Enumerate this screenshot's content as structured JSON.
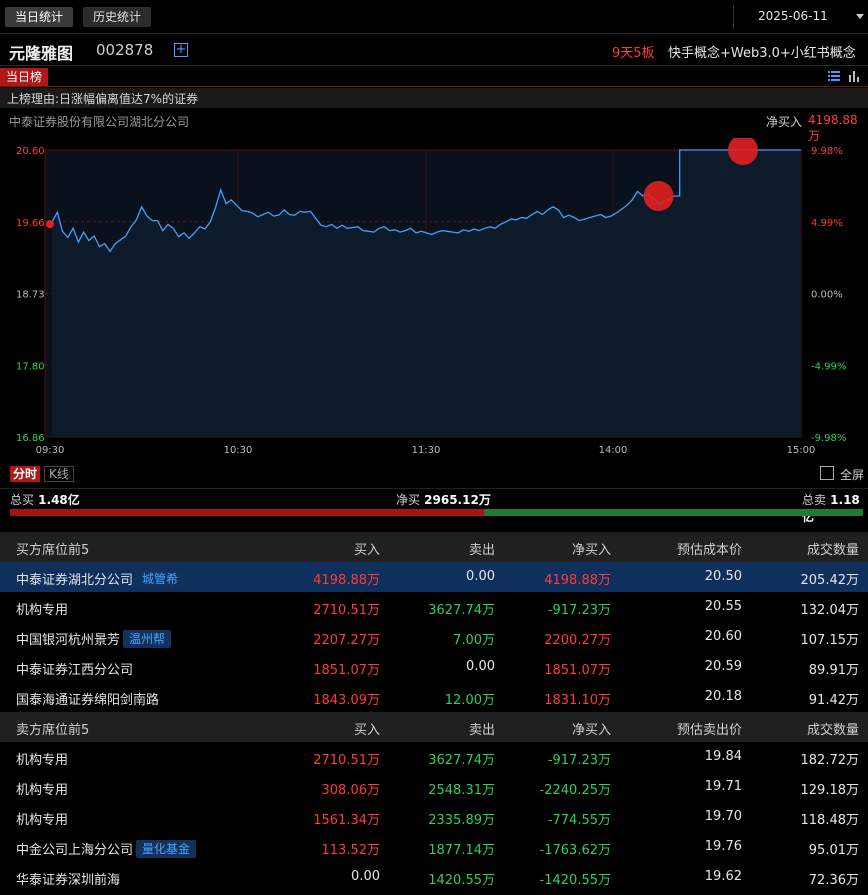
{
  "top_tabs": {
    "today": "当日统计",
    "history": "历史统计"
  },
  "date": "2025-06-11",
  "stock": {
    "name": "元隆雅图",
    "code": "002878",
    "add_symbol": "+",
    "board_count": "9天5板",
    "concepts": "快手概念+Web3.0+小红书概念"
  },
  "rank_tab": "当日榜",
  "reason": "上榜理由:日涨幅偏离值达7%的证券",
  "broker": {
    "name": "中泰证券股份有限公司湖北分公司",
    "net_label": "净买入",
    "net_value": "4198.88万"
  },
  "chart_data": {
    "type": "line",
    "y_price_ticks": [
      "20.60",
      "19.66",
      "18.73",
      "17.80",
      "16.86"
    ],
    "y_pct_ticks": [
      "9.98%",
      "4.99%",
      "0.00%",
      "-4.99%",
      "-9.98%"
    ],
    "x_ticks": [
      "09:30",
      "10:30",
      "11:30",
      "14:00",
      "15:00"
    ],
    "ylim": [
      16.86,
      20.6
    ],
    "prev_close": 18.73,
    "grid": true,
    "series": [
      {
        "values": [
          19.66,
          19.79,
          19.54,
          19.46,
          19.58,
          19.4,
          19.53,
          19.42,
          19.48,
          19.34,
          19.38,
          19.28,
          19.38,
          19.43,
          19.48,
          19.6,
          19.69,
          19.86,
          19.74,
          19.68,
          19.68,
          19.55,
          19.63,
          19.58,
          19.47,
          19.52,
          19.45,
          19.52,
          19.6,
          19.57,
          19.66,
          19.85,
          20.08,
          19.9,
          19.95,
          19.88,
          19.81,
          19.8,
          19.78,
          19.73,
          19.76,
          19.79,
          19.74,
          19.75,
          19.82,
          19.76,
          19.75,
          19.8,
          19.79,
          19.8,
          19.71,
          19.62,
          19.6,
          19.63,
          19.58,
          19.62,
          19.58,
          19.59,
          19.6,
          19.55,
          19.54,
          19.53,
          19.58,
          19.6,
          19.55,
          19.56,
          19.53,
          19.55,
          19.58,
          19.52,
          19.54,
          19.52,
          19.5,
          19.53,
          19.55,
          19.54,
          19.53,
          19.52,
          19.56,
          19.54,
          19.57,
          19.55,
          19.58,
          19.6,
          19.58,
          19.63,
          19.66,
          19.7,
          19.69,
          19.72,
          19.71,
          19.76,
          19.8,
          19.76,
          19.82,
          19.86,
          19.82,
          19.72,
          19.75,
          19.72,
          19.68,
          19.7,
          19.72,
          19.74,
          19.76,
          19.72,
          19.74,
          19.78,
          19.83,
          19.88,
          19.95,
          20.06,
          20.0,
          20.03,
          19.97,
          19.9,
          19.92,
          19.96,
          20.0,
          20.6,
          20.6,
          20.6,
          20.6,
          20.6,
          20.6,
          20.6,
          20.6,
          20.6,
          20.6,
          20.6,
          20.6,
          20.6,
          20.6,
          20.6,
          20.6,
          20.6,
          20.6,
          20.6,
          20.6,
          20.6,
          20.6,
          20.6,
          20.6
        ],
        "color": "#3da2ff"
      }
    ],
    "markers": [
      {
        "index": 0,
        "value": 19.66,
        "size": "small"
      },
      {
        "index": 115,
        "value": 20.0,
        "size": "large"
      },
      {
        "index": 131,
        "value": 20.6,
        "size": "large"
      }
    ],
    "colors": {
      "up": "#ff3b3b",
      "down": "#2fd05a",
      "line": "#3da2ff",
      "marker": "#e02020"
    }
  },
  "chart_modes": {
    "intraday": "分时",
    "kline": "K线",
    "fullscreen": "全屏"
  },
  "totals": {
    "total_buy_label": "总买",
    "total_buy_value": "1.48亿",
    "net_buy_label": "净买",
    "net_buy_value": "2965.12万",
    "total_sell_label": "总卖",
    "total_sell_value": "1.18亿",
    "buy_ratio": 0.556
  },
  "buy_table": {
    "headers": [
      "买方席位前5",
      "买入",
      "卖出",
      "净买入",
      "预估成本价",
      "成交数量"
    ],
    "rows": [
      {
        "name": "中泰证券湖北分公司",
        "tag": "城管希",
        "buy": "4198.88万",
        "sell": "0.00",
        "net": "4198.88万",
        "price": "20.50",
        "volume": "205.42万"
      },
      {
        "name": "机构专用",
        "tag": "",
        "buy": "2710.51万",
        "sell": "3627.74万",
        "net": "-917.23万",
        "price": "20.55",
        "volume": "132.04万"
      },
      {
        "name": "中国银河杭州景芳",
        "tag": "温州帮",
        "buy": "2207.27万",
        "sell": "7.00万",
        "net": "2200.27万",
        "price": "20.60",
        "volume": "107.15万"
      },
      {
        "name": "中泰证券江西分公司",
        "tag": "",
        "buy": "1851.07万",
        "sell": "0.00",
        "net": "1851.07万",
        "price": "20.59",
        "volume": "89.91万"
      },
      {
        "name": "国泰海通证券绵阳剑南路",
        "tag": "",
        "buy": "1843.09万",
        "sell": "12.00万",
        "net": "1831.10万",
        "price": "20.18",
        "volume": "91.42万"
      }
    ]
  },
  "sell_table": {
    "headers": [
      "卖方席位前5",
      "买入",
      "卖出",
      "净买入",
      "预估卖出价",
      "成交数量"
    ],
    "rows": [
      {
        "name": "机构专用",
        "tag": "",
        "buy": "2710.51万",
        "sell": "3627.74万",
        "net": "-917.23万",
        "price": "19.84",
        "volume": "182.72万"
      },
      {
        "name": "机构专用",
        "tag": "",
        "buy": "308.06万",
        "sell": "2548.31万",
        "net": "-2240.25万",
        "price": "19.71",
        "volume": "129.18万"
      },
      {
        "name": "机构专用",
        "tag": "",
        "buy": "1561.34万",
        "sell": "2335.89万",
        "net": "-774.55万",
        "price": "19.70",
        "volume": "118.48万"
      },
      {
        "name": "中金公司上海分公司",
        "tag": "量化基金",
        "buy": "113.52万",
        "sell": "1877.14万",
        "net": "-1763.62万",
        "price": "19.76",
        "volume": "95.01万"
      },
      {
        "name": "华泰证券深圳前海",
        "tag": "",
        "buy": "0.00",
        "sell": "1420.55万",
        "net": "-1420.55万",
        "price": "19.62",
        "volume": "72.36万"
      }
    ]
  }
}
